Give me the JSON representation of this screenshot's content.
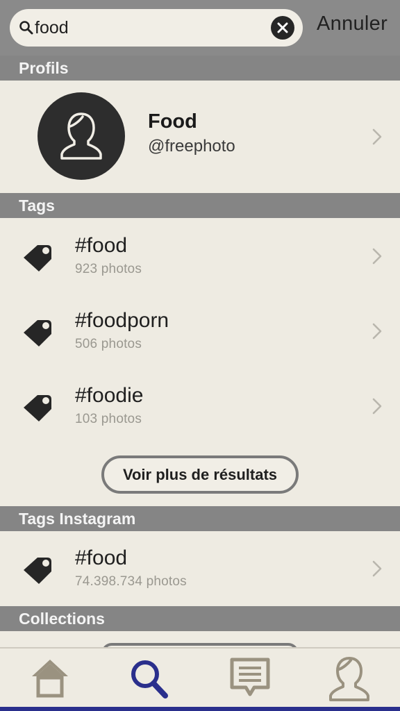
{
  "search": {
    "value": "food",
    "cancel_label": "Annuler"
  },
  "sections": {
    "profiles": "Profils",
    "tags": "Tags",
    "instagram_tags": "Tags Instagram",
    "collections": "Collections"
  },
  "profile": {
    "name": "Food",
    "handle": "@freephoto"
  },
  "tags": [
    {
      "name": "#food",
      "count": "923 photos"
    },
    {
      "name": "#foodporn",
      "count": "506 photos"
    },
    {
      "name": "#foodie",
      "count": "103 photos"
    }
  ],
  "more_results_label": "Voir plus de résultats",
  "instagram_tags": [
    {
      "name": "#food",
      "count": "74.398.734 photos"
    }
  ],
  "tab_bar": {
    "items": [
      "home-icon",
      "search-icon",
      "messages-icon",
      "profile-icon"
    ],
    "active": "search-icon"
  },
  "colors": {
    "background": "#eeebe2",
    "header": "#858585",
    "accent": "#2a2f8c",
    "icon_tan": "#9a9280"
  }
}
